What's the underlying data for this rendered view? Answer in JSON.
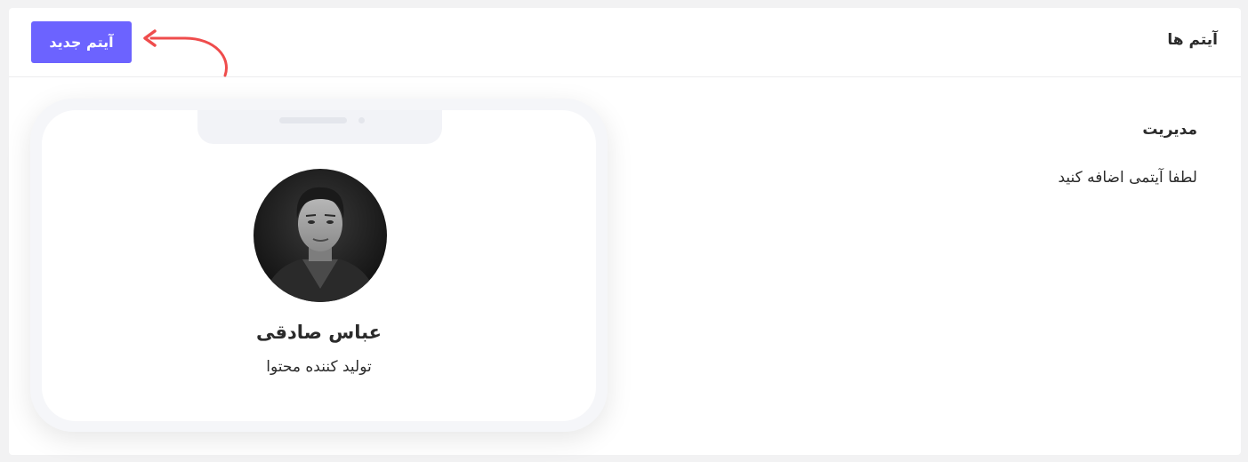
{
  "header": {
    "title": "آیتم ها",
    "new_item_label": "آیتم جدید"
  },
  "main": {
    "section_title": "مدیریت",
    "empty_message": "لطفا آیتمی اضافه کنید"
  },
  "preview": {
    "name": "عباس صادقی",
    "role": "تولید کننده محتوا"
  },
  "colors": {
    "accent": "#6c63ff",
    "arrow": "#ef4c4c",
    "background": "#f2f2f3",
    "card": "#ffffff"
  },
  "icons": {
    "arrow": "curved-arrow-icon",
    "avatar": "avatar-photo"
  }
}
